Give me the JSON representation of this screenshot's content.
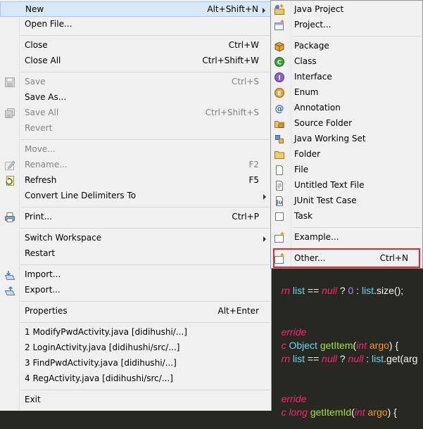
{
  "menu": {
    "items": [
      {
        "label": "New",
        "shortcut": "Alt+Shift+N"
      },
      {
        "label": "Open File...",
        "shortcut": ""
      },
      {
        "label": "Close",
        "shortcut": "Ctrl+W"
      },
      {
        "label": "Close All",
        "shortcut": "Ctrl+Shift+W"
      },
      {
        "label": "Save",
        "shortcut": "Ctrl+S"
      },
      {
        "label": "Save As...",
        "shortcut": ""
      },
      {
        "label": "Save All",
        "shortcut": "Ctrl+Shift+S"
      },
      {
        "label": "Revert",
        "shortcut": ""
      },
      {
        "label": "Move...",
        "shortcut": ""
      },
      {
        "label": "Rename...",
        "shortcut": "F2"
      },
      {
        "label": "Refresh",
        "shortcut": "F5"
      },
      {
        "label": "Convert Line Delimiters To",
        "shortcut": ""
      },
      {
        "label": "Print...",
        "shortcut": "Ctrl+P"
      },
      {
        "label": "Switch Workspace",
        "shortcut": ""
      },
      {
        "label": "Restart",
        "shortcut": ""
      },
      {
        "label": "Import...",
        "shortcut": ""
      },
      {
        "label": "Export...",
        "shortcut": ""
      },
      {
        "label": "Properties",
        "shortcut": "Alt+Enter"
      },
      {
        "label": "1 ModifyPwdActivity.java  [didihushi/...]",
        "shortcut": ""
      },
      {
        "label": "2 LoginActivity.java  [didihushi/src/...]",
        "shortcut": ""
      },
      {
        "label": "3 FindPwdActivity.java  [didihushi/...]",
        "shortcut": ""
      },
      {
        "label": "4 RegActivity.java  [didihushi/src/...]",
        "shortcut": ""
      },
      {
        "label": "Exit",
        "shortcut": ""
      }
    ]
  },
  "submenu": {
    "items": [
      {
        "label": "Java Project",
        "shortcut": ""
      },
      {
        "label": "Project...",
        "shortcut": ""
      },
      {
        "label": "Package",
        "shortcut": ""
      },
      {
        "label": "Class",
        "shortcut": ""
      },
      {
        "label": "Interface",
        "shortcut": ""
      },
      {
        "label": "Enum",
        "shortcut": ""
      },
      {
        "label": "Annotation",
        "shortcut": ""
      },
      {
        "label": "Source Folder",
        "shortcut": ""
      },
      {
        "label": "Java Working Set",
        "shortcut": ""
      },
      {
        "label": "Folder",
        "shortcut": ""
      },
      {
        "label": "File",
        "shortcut": ""
      },
      {
        "label": "Untitled Text File",
        "shortcut": ""
      },
      {
        "label": "JUnit Test Case",
        "shortcut": ""
      },
      {
        "label": "Task",
        "shortcut": ""
      },
      {
        "label": "Example...",
        "shortcut": ""
      },
      {
        "label": "Other...",
        "shortcut": "Ctrl+N"
      }
    ]
  },
  "code": {
    "l1": {
      "a": "rn ",
      "b": "list",
      "c": " == ",
      "d": "null",
      "e": " ? ",
      "f": "0",
      "g": " : ",
      "h": "list",
      "i": ".size();"
    },
    "l2": {
      "a": "erride"
    },
    "l3": {
      "a": "c ",
      "b": "Object",
      "c": " ",
      "d": "getItem",
      "e": "(",
      "f": "int",
      "g": " ",
      "h": "argo",
      "i": ") {"
    },
    "l4": {
      "a": "rn ",
      "b": "list",
      "c": " == ",
      "d": "null",
      "e": " ? ",
      "f": "null",
      "g": " : ",
      "h": "list",
      "i": ".get(arg"
    },
    "l5": {
      "a": "erride"
    },
    "l6": {
      "a": "c ",
      "b": "long",
      "c": " ",
      "d": "getItemId",
      "e": "(",
      "f": "int",
      "g": " ",
      "h": "argo",
      "i": ") {"
    }
  }
}
